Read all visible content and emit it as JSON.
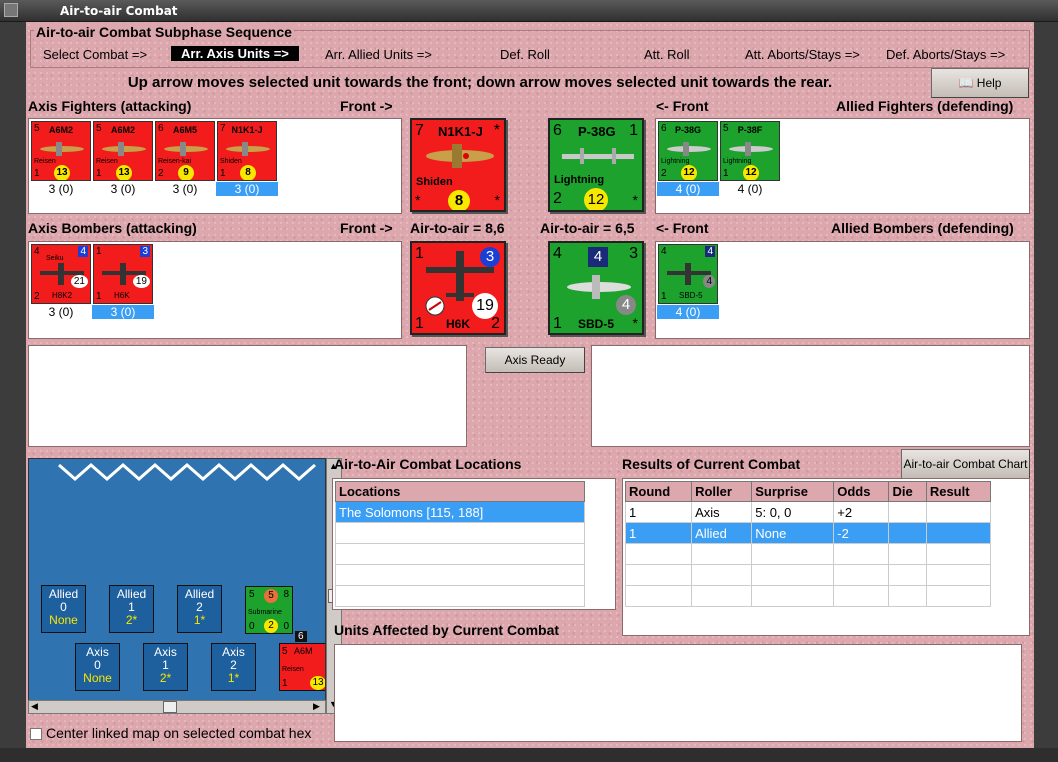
{
  "window": {
    "title": "Air-to-air Combat"
  },
  "sequence": {
    "title": "Air-to-air Combat Subphase Sequence",
    "steps": [
      "Select Combat =>",
      "Arr. Axis Units =>",
      "Arr. Allied Units =>",
      "Def. Roll",
      "Att. Roll",
      "Att. Aborts/Stays =>",
      "Def. Aborts/Stays =>"
    ],
    "active_index": 1
  },
  "instruction": "Up arrow moves selected unit towards the front; down arrow moves selected unit towards the rear.",
  "help_button": "Help",
  "axis_fighters": {
    "label": "Axis Fighters (attacking)",
    "front": "Front ->",
    "units": [
      {
        "name": "A6M2",
        "sub": "Reisen",
        "a": "5",
        "d": "1",
        "y": "13",
        "cap": "3 (0)"
      },
      {
        "name": "A6M2",
        "sub": "Reisen",
        "a": "5",
        "d": "1",
        "y": "13",
        "cap": "3 (0)"
      },
      {
        "name": "A6M5",
        "sub": "Reisen-kai",
        "a": "6",
        "d": "2",
        "y": "9",
        "cap": "3 (0)"
      },
      {
        "name": "N1K1-J",
        "sub": "Shiden",
        "a": "7",
        "d": "1",
        "y": "8",
        "cap": "3 (0)"
      }
    ],
    "selected": 3
  },
  "allied_fighters": {
    "label": "Allied Fighters (defending)",
    "front": "<- Front",
    "units": [
      {
        "name": "P-38G",
        "sub": "Lightning",
        "a": "6",
        "d": "2",
        "y": "12",
        "cap": "4 (0)"
      },
      {
        "name": "P-38F",
        "sub": "Lightning",
        "a": "5",
        "d": "1",
        "y": "12",
        "cap": "4 (0)"
      }
    ],
    "selected": 0
  },
  "axis_bombers": {
    "label": "Axis Bombers (attacking)",
    "front": "Front ->",
    "units": [
      {
        "name": "Seiku",
        "sub": "H8K2",
        "a": "4",
        "d": "2",
        "b": "4",
        "v": "21",
        "cap": "3 (0)"
      },
      {
        "name": "H6K",
        "sub": "H6K",
        "a": "1",
        "d": "1",
        "b": "3",
        "v": "19",
        "cap": "3 (0)"
      }
    ],
    "selected": 1
  },
  "allied_bombers": {
    "label": "Allied Bombers (defending)",
    "front": "<- Front",
    "units": [
      {
        "name": "SBD-5",
        "a": "4",
        "d": "1",
        "b": "4",
        "v": "4",
        "cap": "4 (0)"
      }
    ],
    "selected": 0
  },
  "big_axis_fighter": {
    "a": "7",
    "name": "N1K1-J",
    "sub": "Shiden",
    "star": "*",
    "y": "8"
  },
  "big_allied_fighter": {
    "a": "6",
    "name": "P-38G",
    "b": "1",
    "sub": "Lightning",
    "d": "2",
    "y": "12",
    "star": "*"
  },
  "big_axis_bomber": {
    "a": "1",
    "b": "3",
    "v": "19",
    "d": "1",
    "name": "H6K",
    "e": "2"
  },
  "big_allied_bomber": {
    "a": "4",
    "b": "4",
    "c": "3",
    "v": "4",
    "d": "1",
    "name": "SBD-5",
    "star": "*"
  },
  "air_to_air_axis": "Air-to-air = 8,6",
  "air_to_air_allied": "Air-to-air = 6,5",
  "axis_ready": "Axis Ready",
  "locations": {
    "title": "Air-to-Air Combat Locations",
    "header": "Locations",
    "rows": [
      "The Solomons [115, 188]"
    ]
  },
  "results": {
    "title": "Results of Current Combat",
    "chart_button": "Air-to-air Combat Chart",
    "headers": [
      "Round",
      "Roller",
      "Surprise",
      "Odds",
      "Die",
      "Result"
    ],
    "rows": [
      [
        "1",
        "Axis",
        "5: 0, 0",
        "+2",
        "",
        ""
      ],
      [
        "1",
        "Allied",
        "None",
        "-2",
        "",
        ""
      ]
    ]
  },
  "units_affected": {
    "title": "Units Affected by Current Combat"
  },
  "map": {
    "allied": [
      {
        "l": "Allied",
        "n": "0",
        "v": "None"
      },
      {
        "l": "Allied",
        "n": "1",
        "v": "2*"
      },
      {
        "l": "Allied",
        "n": "2",
        "v": "1*"
      }
    ],
    "axis": [
      {
        "l": "Axis",
        "n": "0",
        "v": "None"
      },
      {
        "l": "Axis",
        "n": "1",
        "v": "2*"
      },
      {
        "l": "Axis",
        "n": "2",
        "v": "1*"
      }
    ],
    "sub": {
      "t": "Submarine",
      "a": "5",
      "b": "5",
      "c": "8",
      "d": "0",
      "e": "2",
      "f": "0"
    },
    "stack": "6",
    "peek": {
      "n": "A6M",
      "s": "Reisen",
      "a": "5",
      "d": "1",
      "y": "13"
    }
  },
  "center_checkbox": "Center linked map on selected combat hex"
}
